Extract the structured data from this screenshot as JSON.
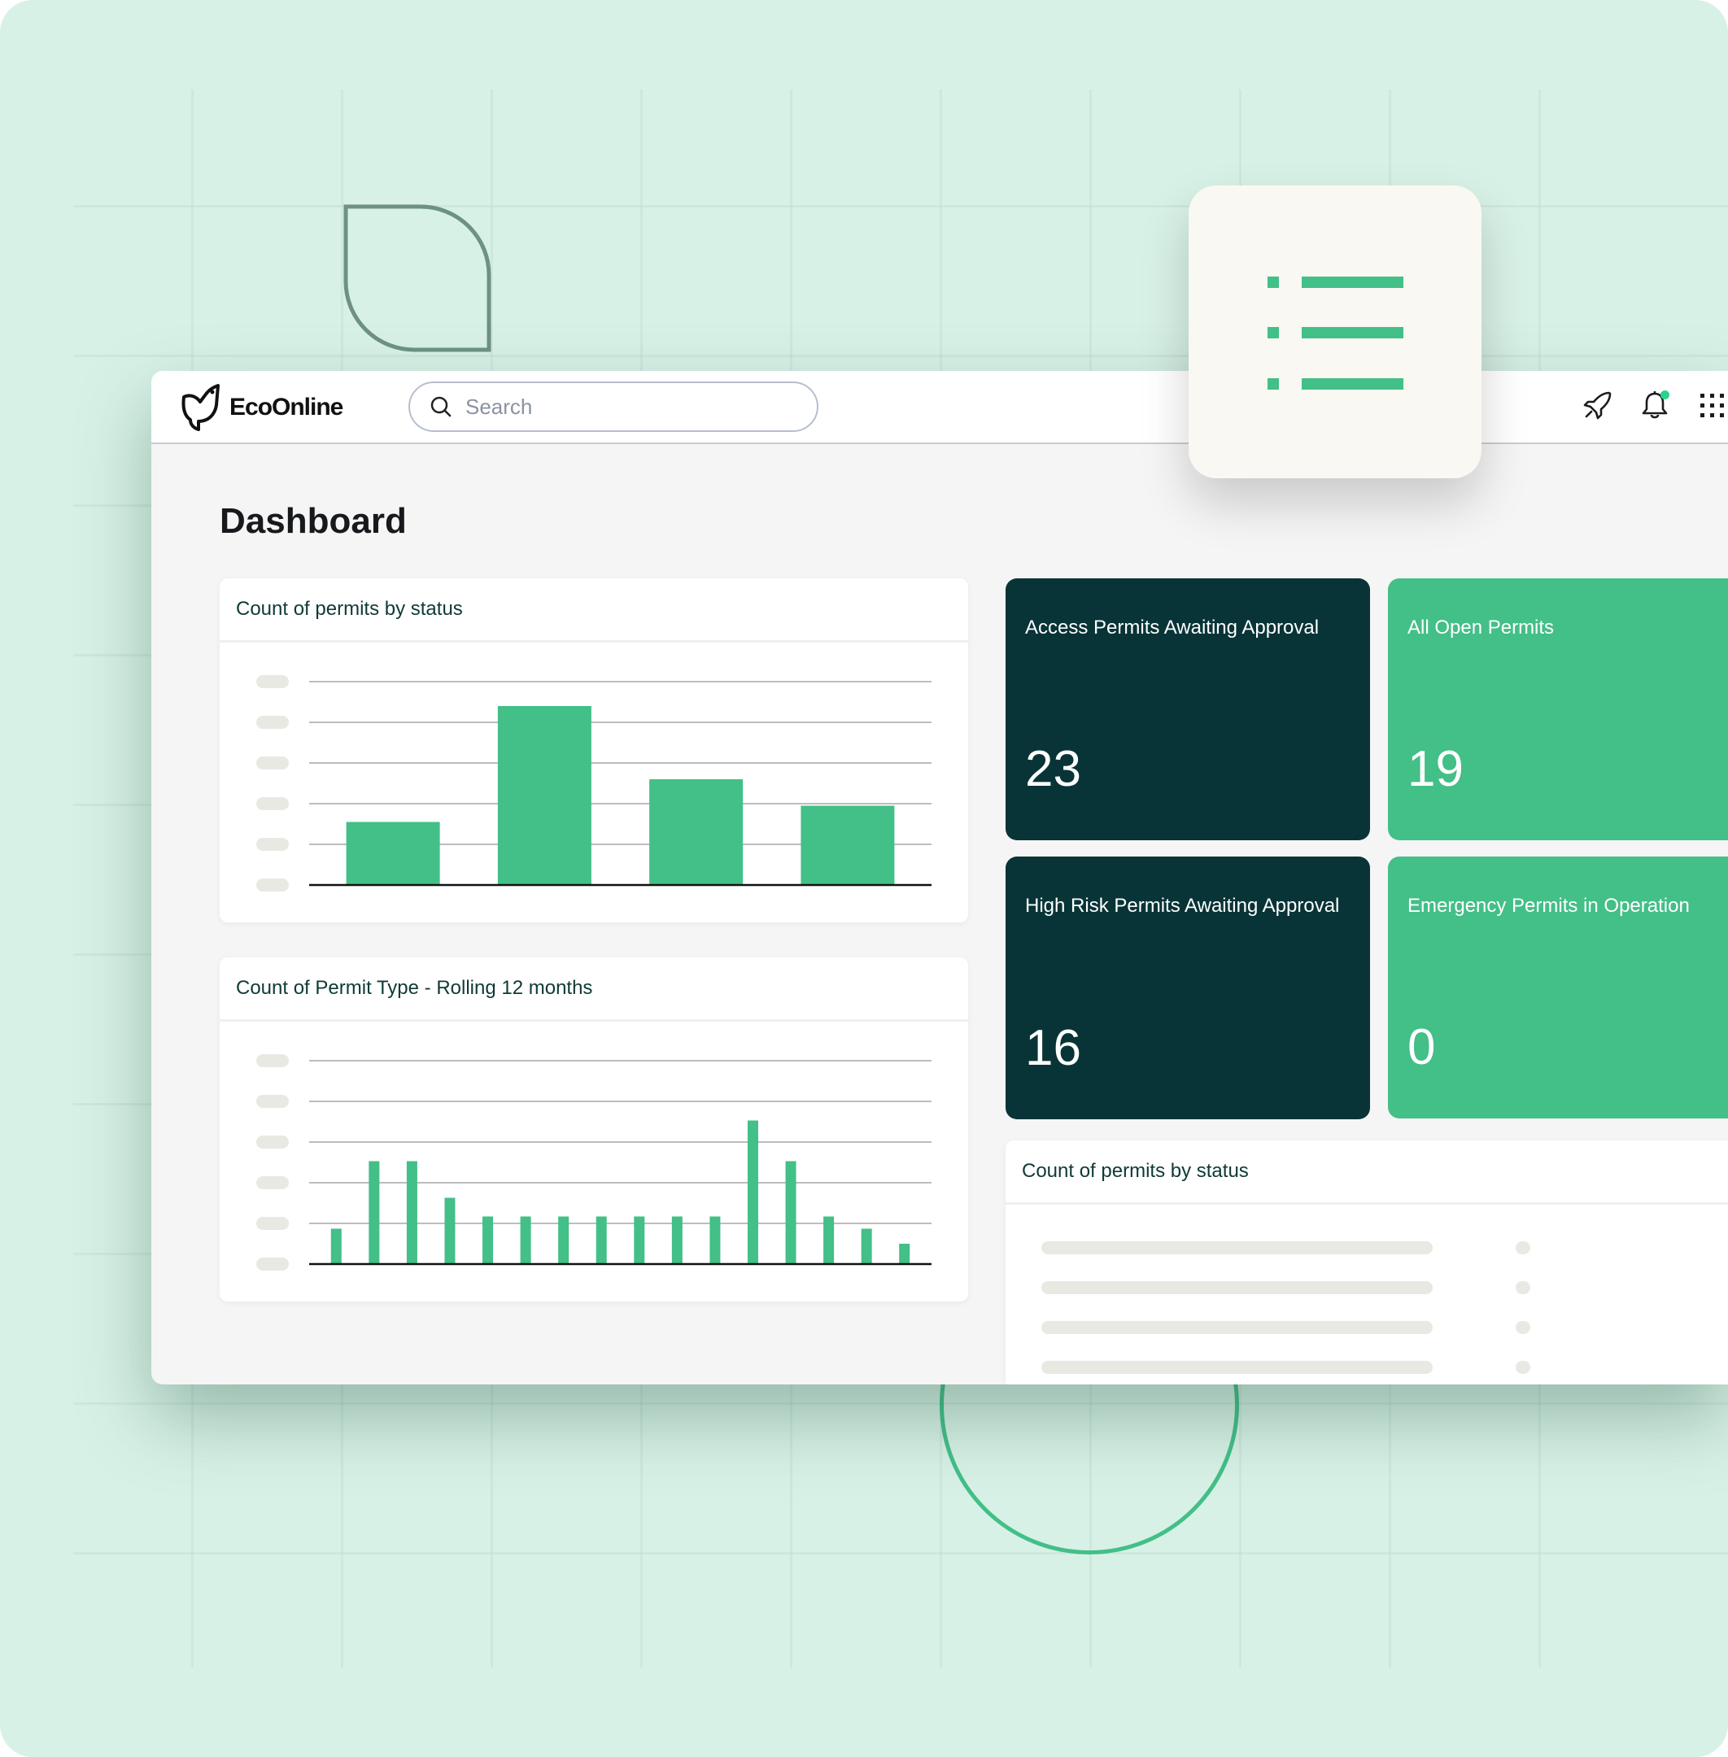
{
  "header": {
    "brand": "EcoOnline",
    "search_placeholder": "Search",
    "icons": [
      "rocket-icon",
      "bell-icon",
      "apps-grid-icon"
    ],
    "has_notification": true
  },
  "page": {
    "title": "Dashboard"
  },
  "colors": {
    "accent": "#43bf88",
    "dark": "#083437",
    "notification": "#2bd28a",
    "background": "#d8f1e6"
  },
  "floating_card": {
    "icon": "list-icon"
  },
  "stats": [
    {
      "label": "Access Permits Awaiting Approval",
      "value": "23",
      "theme": "dark"
    },
    {
      "label": "All Open Permits",
      "value": "19",
      "theme": "green"
    },
    {
      "label": "High Risk Permits Awaiting Approval",
      "value": "16",
      "theme": "dark"
    },
    {
      "label": "Emergency Permits in Operation",
      "value": "0",
      "theme": "green"
    }
  ],
  "list_card": {
    "title": "Count of permits by status",
    "rows": 4
  },
  "chart_data": [
    {
      "type": "bar",
      "title": "Count of permits by status",
      "categories": [
        "",
        "",
        "",
        ""
      ],
      "values": [
        1.55,
        4.4,
        2.6,
        1.95
      ],
      "ylim": [
        0,
        5
      ],
      "yticks_placeholder": 6,
      "xlabel": "",
      "ylabel": "",
      "grid": true
    },
    {
      "type": "bar",
      "title": "Count of Permit Type - Rolling 12 months",
      "categories": [
        "",
        "",
        "",
        "",
        "",
        "",
        "",
        "",
        "",
        "",
        "",
        "",
        "",
        "",
        "",
        ""
      ],
      "values": [
        0.87,
        2.53,
        2.53,
        1.63,
        1.17,
        1.17,
        1.17,
        1.17,
        1.17,
        1.17,
        1.17,
        3.53,
        2.53,
        1.17,
        0.87,
        0.5
      ],
      "ylim": [
        0,
        5
      ],
      "yticks_placeholder": 6,
      "xlabel": "",
      "ylabel": "",
      "grid": true
    }
  ]
}
